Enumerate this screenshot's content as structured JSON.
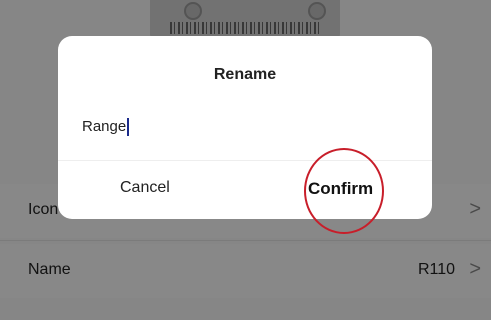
{
  "settings": {
    "icon_label": "Icon",
    "name_label": "Name",
    "name_value": "R110",
    "chevron": ">"
  },
  "dialog": {
    "title": "Rename",
    "input_value": "Range",
    "cancel_label": "Cancel",
    "confirm_label": "Confirm"
  },
  "colors": {
    "annotation": "#c81e2a",
    "caret": "#1a2a8a"
  }
}
